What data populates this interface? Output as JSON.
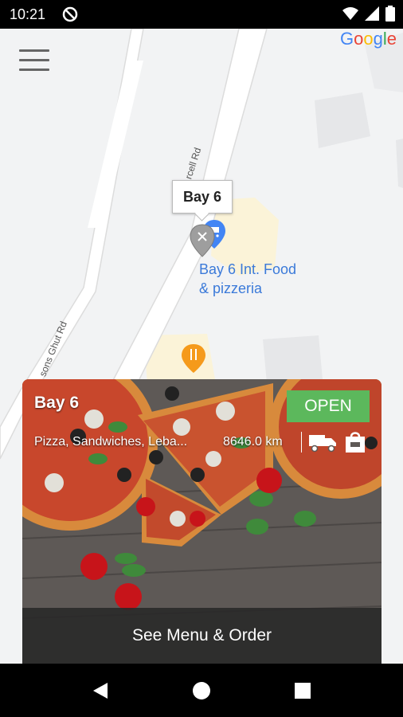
{
  "status_bar": {
    "time": "10:21",
    "left_icons": [
      "do-not-disturb-icon"
    ],
    "right_icons": [
      "wifi-icon",
      "signal-icon",
      "battery-icon"
    ]
  },
  "map": {
    "provider": "Google",
    "road_labels": [
      "rcell Rd",
      "sons Ghut Rd"
    ],
    "marker_callout": "Bay 6",
    "poi_label_line1": "Bay 6 Int. Food",
    "poi_label_line2": "& pizzeria",
    "icons": [
      "shopping-cart-pin-icon",
      "restaurant-pin-icon",
      "selected-marker-icon"
    ]
  },
  "card": {
    "name": "Bay 6",
    "status": "OPEN",
    "cuisine": "Pizza, Sandwiches, Leba...",
    "distance": "8646.0 km",
    "service_icons": [
      "delivery-truck-icon",
      "takeaway-bag-icon"
    ],
    "cta": "See Menu & Order",
    "colors": {
      "open": "#5cb85c",
      "cta_bg": "#282828"
    }
  },
  "navbar": {
    "buttons": [
      "back-icon",
      "home-icon",
      "recents-icon"
    ]
  }
}
